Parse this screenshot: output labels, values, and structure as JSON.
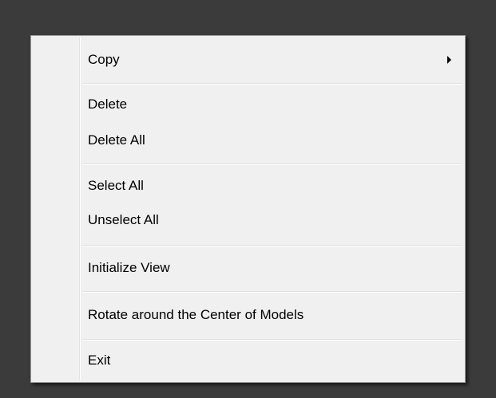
{
  "context_menu": {
    "items": [
      {
        "label": "Copy",
        "has_submenu": true,
        "submenu_icon": "chevron-right-icon"
      },
      {
        "label": "Delete"
      },
      {
        "label": "Delete All"
      },
      {
        "label": "Select All"
      },
      {
        "label": "Unselect All"
      },
      {
        "label": "Initialize View"
      },
      {
        "label": "Rotate around the Center of Models"
      },
      {
        "label": "Exit"
      }
    ]
  },
  "colors": {
    "desktop_background": "#3b3b3b",
    "menu_background": "#f0f0f0",
    "menu_border": "#979797",
    "text": "#000000"
  }
}
